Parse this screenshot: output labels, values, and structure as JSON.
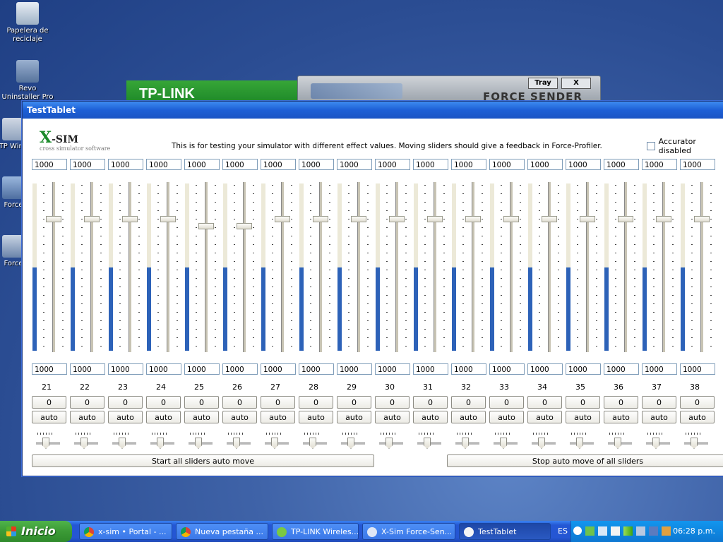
{
  "desktop": {
    "icons": [
      {
        "label": "Papelera de reciclaje"
      },
      {
        "label": "Revo Uninstaller Pro"
      },
      {
        "label": "TP Wirel"
      },
      {
        "label": "Force"
      },
      {
        "label": "Force"
      }
    ],
    "bg_windows": {
      "tplink_title": "TP-LINK",
      "xsim_tray_button": "Tray",
      "xsim_close_button": "X",
      "xsim_caption": "FORCE SENDER"
    }
  },
  "window": {
    "title": "TestTablet",
    "logo_x": "X",
    "logo_sim": "-SIM",
    "logo_subtitle": "cross simulator software",
    "info_text": "This is for testing your simulator with different effect values. Moving sliders should give a feedback in Force-Profiler.",
    "accurator_label": "Accurator disabled",
    "channels": [
      {
        "top_value": "1000",
        "bottom_value": "1000",
        "number": "21",
        "offset": "0",
        "auto_label": "auto",
        "level": 0.5,
        "slider_pos": 0.2
      },
      {
        "top_value": "1000",
        "bottom_value": "1000",
        "number": "22",
        "offset": "0",
        "auto_label": "auto",
        "level": 0.5,
        "slider_pos": 0.2
      },
      {
        "top_value": "1000",
        "bottom_value": "1000",
        "number": "23",
        "offset": "0",
        "auto_label": "auto",
        "level": 0.5,
        "slider_pos": 0.2
      },
      {
        "top_value": "1000",
        "bottom_value": "1000",
        "number": "24",
        "offset": "0",
        "auto_label": "auto",
        "level": 0.5,
        "slider_pos": 0.2
      },
      {
        "top_value": "1000",
        "bottom_value": "1000",
        "number": "25",
        "offset": "0",
        "auto_label": "auto",
        "level": 0.5,
        "slider_pos": 0.24
      },
      {
        "top_value": "1000",
        "bottom_value": "1000",
        "number": "26",
        "offset": "0",
        "auto_label": "auto",
        "level": 0.5,
        "slider_pos": 0.24
      },
      {
        "top_value": "1000",
        "bottom_value": "1000",
        "number": "27",
        "offset": "0",
        "auto_label": "auto",
        "level": 0.5,
        "slider_pos": 0.2
      },
      {
        "top_value": "1000",
        "bottom_value": "1000",
        "number": "28",
        "offset": "0",
        "auto_label": "auto",
        "level": 0.5,
        "slider_pos": 0.2
      },
      {
        "top_value": "1000",
        "bottom_value": "1000",
        "number": "29",
        "offset": "0",
        "auto_label": "auto",
        "level": 0.5,
        "slider_pos": 0.2
      },
      {
        "top_value": "1000",
        "bottom_value": "1000",
        "number": "30",
        "offset": "0",
        "auto_label": "auto",
        "level": 0.5,
        "slider_pos": 0.2
      },
      {
        "top_value": "1000",
        "bottom_value": "1000",
        "number": "31",
        "offset": "0",
        "auto_label": "auto",
        "level": 0.5,
        "slider_pos": 0.2
      },
      {
        "top_value": "1000",
        "bottom_value": "1000",
        "number": "32",
        "offset": "0",
        "auto_label": "auto",
        "level": 0.5,
        "slider_pos": 0.2
      },
      {
        "top_value": "1000",
        "bottom_value": "1000",
        "number": "33",
        "offset": "0",
        "auto_label": "auto",
        "level": 0.5,
        "slider_pos": 0.2
      },
      {
        "top_value": "1000",
        "bottom_value": "1000",
        "number": "34",
        "offset": "0",
        "auto_label": "auto",
        "level": 0.5,
        "slider_pos": 0.2
      },
      {
        "top_value": "1000",
        "bottom_value": "1000",
        "number": "35",
        "offset": "0",
        "auto_label": "auto",
        "level": 0.5,
        "slider_pos": 0.2
      },
      {
        "top_value": "1000",
        "bottom_value": "1000",
        "number": "36",
        "offset": "0",
        "auto_label": "auto",
        "level": 0.5,
        "slider_pos": 0.2
      },
      {
        "top_value": "1000",
        "bottom_value": "1000",
        "number": "37",
        "offset": "0",
        "auto_label": "auto",
        "level": 0.5,
        "slider_pos": 0.2
      },
      {
        "top_value": "1000",
        "bottom_value": "1000",
        "number": "38",
        "offset": "0",
        "auto_label": "auto",
        "level": 0.5,
        "slider_pos": 0.2
      }
    ],
    "start_all_label": "Start all sliders auto move",
    "stop_all_label": "Stop auto move of all sliders"
  },
  "taskbar": {
    "start_label": "Inicio",
    "tasks": [
      {
        "label": "x-sim • Portal - ...",
        "icon": "chrome-icon",
        "active": false
      },
      {
        "label": "Nueva pestaña ...",
        "icon": "chrome-icon",
        "active": false
      },
      {
        "label": "TP-LINK Wireles...",
        "icon": "tplink-icon",
        "active": false
      },
      {
        "label": "X-Sim Force-Sen...",
        "icon": "xsim-icon",
        "active": false
      },
      {
        "label": "TestTablet",
        "icon": "lightbulb-icon",
        "active": true
      }
    ],
    "language": "ES",
    "clock": "06:28 p.m."
  },
  "colors": {
    "meter_fill": "#2d62b8",
    "titlebar": "#1d5fd6",
    "taskbar": "#2457d4",
    "start_button": "#3b9a36"
  }
}
